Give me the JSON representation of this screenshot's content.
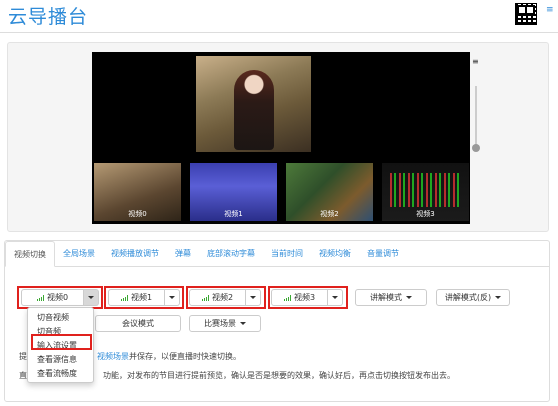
{
  "header": {
    "title": "云导播台",
    "qr_icon": "qr-code-icon",
    "menu_icon": "hamburger-icon",
    "accent": "#2e8bd8"
  },
  "preview": {
    "thumbnails": [
      {
        "label": "视频0"
      },
      {
        "label": "视频1"
      },
      {
        "label": "视频2"
      },
      {
        "label": "视频3"
      }
    ],
    "side_icon": "list-icon"
  },
  "tabs": [
    {
      "label": "视频切换",
      "active": true
    },
    {
      "label": "全局场景"
    },
    {
      "label": "视频播放调节"
    },
    {
      "label": "弹幕"
    },
    {
      "label": "底部滚动字幕"
    },
    {
      "label": "当前时间"
    },
    {
      "label": "视频均衡"
    },
    {
      "label": "音量调节"
    }
  ],
  "switch": {
    "video_buttons": [
      {
        "label": "视频0"
      },
      {
        "label": "视频1"
      },
      {
        "label": "视频2"
      },
      {
        "label": "视频3"
      }
    ],
    "commentary_mode": "讲解模式",
    "commentary_mode_reverse": "讲解模式(反)",
    "meeting_mode": "会议模式",
    "match_scene": "比赛场景",
    "highlight_color": "#e0211d"
  },
  "dropdown": {
    "items": [
      {
        "label": "切音视频"
      },
      {
        "label": "切音频"
      },
      {
        "label": "输入流设置",
        "highlighted": true
      },
      {
        "label": "查看源信息"
      },
      {
        "label": "查看流畅度"
      }
    ]
  },
  "help": {
    "line1_prefix": "提",
    "line1_link": "视频场景",
    "line1_suffix": "并保存，以便直播时快速切换。",
    "line2_prefix": "直",
    "line2_suffix": "功能，对发布的节目进行提前预览，确认是否是想要的效果，确认好后，再点击切换按钮发布出去。"
  }
}
